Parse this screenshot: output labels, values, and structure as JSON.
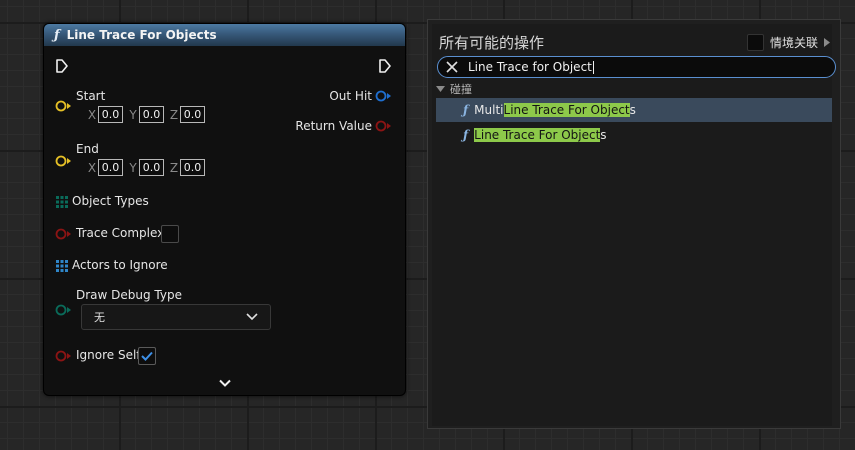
{
  "node": {
    "title": "Line Trace For Objects",
    "icon": "function-icon",
    "start_label": "Start",
    "end_label": "End",
    "start": {
      "x": "0.0",
      "y": "0.0",
      "z": "0.0"
    },
    "end": {
      "x": "0.0",
      "y": "0.0",
      "z": "0.0"
    },
    "axis_x": "X",
    "axis_y": "Y",
    "axis_z": "Z",
    "out_hit_label": "Out Hit",
    "return_value_label": "Return Value",
    "object_types_label": "Object Types",
    "trace_complex_label": "Trace Complex",
    "trace_complex_checked": false,
    "actors_to_ignore_label": "Actors to Ignore",
    "draw_debug_type_label": "Draw Debug Type",
    "draw_debug_type_value": "无",
    "ignore_self_label": "Ignore Self",
    "ignore_self_checked": true,
    "colors": {
      "vector_pin": "#e6c026",
      "struct_pin": "#1f6fd0",
      "bool_pin": "#8c1414",
      "enum_pin": "#0a6b5a",
      "array_pin": "#2f86c9",
      "header": "#3b5f82"
    }
  },
  "action_menu": {
    "title": "所有可能的操作",
    "context_label": "情境关联",
    "context_checked": false,
    "search_value": "Line Trace for Object",
    "category": "碰撞",
    "results": [
      {
        "prefix": "Multi ",
        "match": "Line Trace For Object",
        "suffix": "s",
        "selected": true
      },
      {
        "prefix": "",
        "match": "Line Trace For Object",
        "suffix": "s",
        "selected": false
      }
    ],
    "colors": {
      "highlight": "#8dc94a",
      "selected_row": "#3a4a5c",
      "search_border": "#5a8fd0"
    }
  }
}
